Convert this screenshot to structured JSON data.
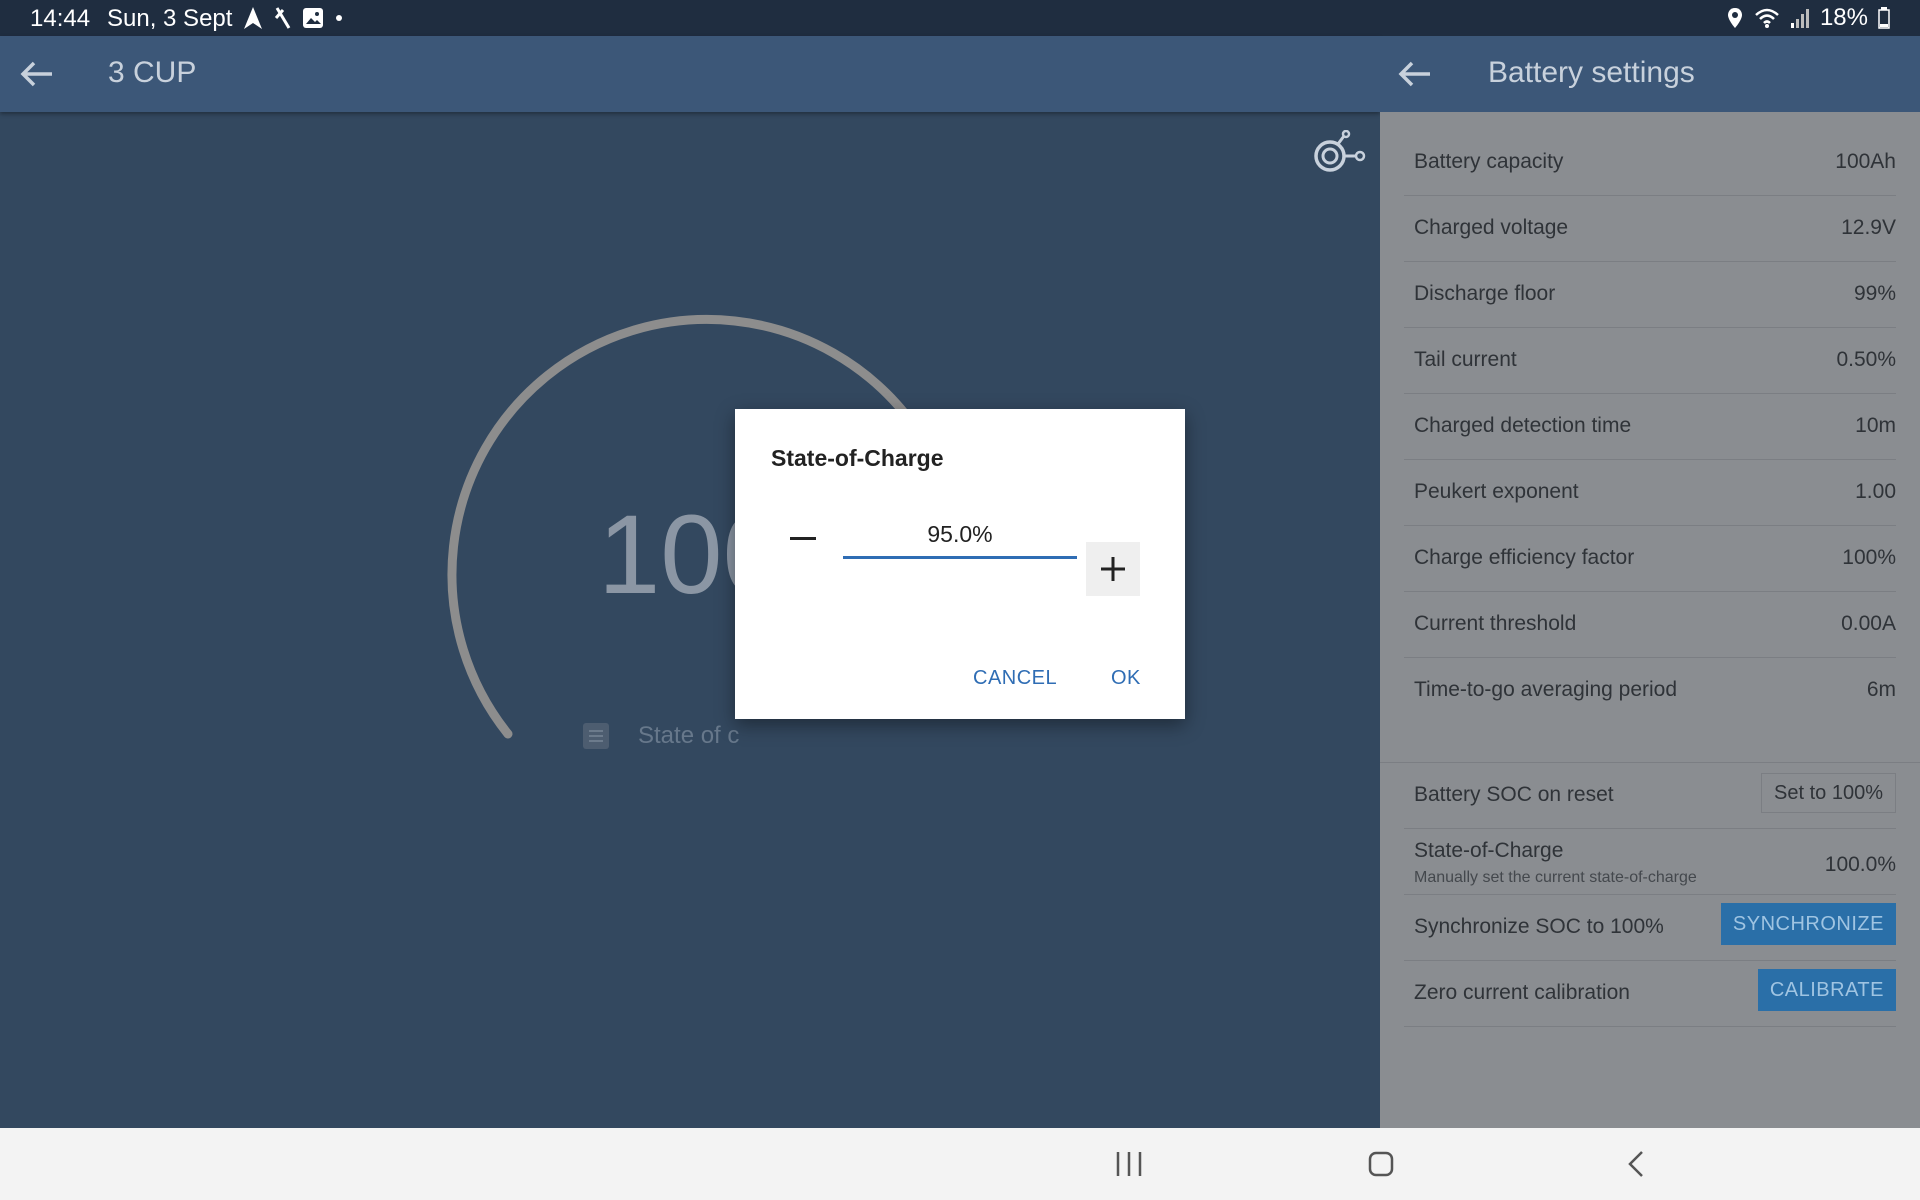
{
  "status_bar": {
    "time": "14:44",
    "date": "Sun, 3 Sept",
    "battery_percent": "18%"
  },
  "left_app": {
    "title": "3 CUP",
    "gauge_value": "100",
    "gauge_label": "State of c"
  },
  "right_panel": {
    "title": "Battery settings",
    "settings": [
      {
        "label": "Battery capacity",
        "value": "100Ah"
      },
      {
        "label": "Charged voltage",
        "value": "12.9V"
      },
      {
        "label": "Discharge floor",
        "value": "99%"
      },
      {
        "label": "Tail current",
        "value": "0.50%"
      },
      {
        "label": "Charged detection time",
        "value": "10m"
      },
      {
        "label": "Peukert exponent",
        "value": "1.00"
      },
      {
        "label": "Charge efficiency factor",
        "value": "100%"
      },
      {
        "label": "Current threshold",
        "value": "0.00A"
      },
      {
        "label": "Time-to-go averaging period",
        "value": "6m"
      }
    ],
    "soc_on_reset": {
      "label": "Battery SOC on reset",
      "value": "Set to 100%"
    },
    "state_of_charge": {
      "label": "State-of-Charge",
      "sublabel": "Manually set the current state-of-charge",
      "value": "100.0%"
    },
    "synchronize": {
      "label": "Synchronize SOC to 100%",
      "button": "SYNCHRONIZE"
    },
    "calibrate": {
      "label": "Zero current calibration",
      "button": "CALIBRATE"
    }
  },
  "dialog": {
    "title": "State-of-Charge",
    "input_value": "95.0%",
    "cancel_label": "CANCEL",
    "ok_label": "OK"
  },
  "colors": {
    "header": "#3c5778",
    "left_background": "#33485f",
    "accent_blue": "#2f6db4",
    "button_blue": "#2a6fa8"
  }
}
